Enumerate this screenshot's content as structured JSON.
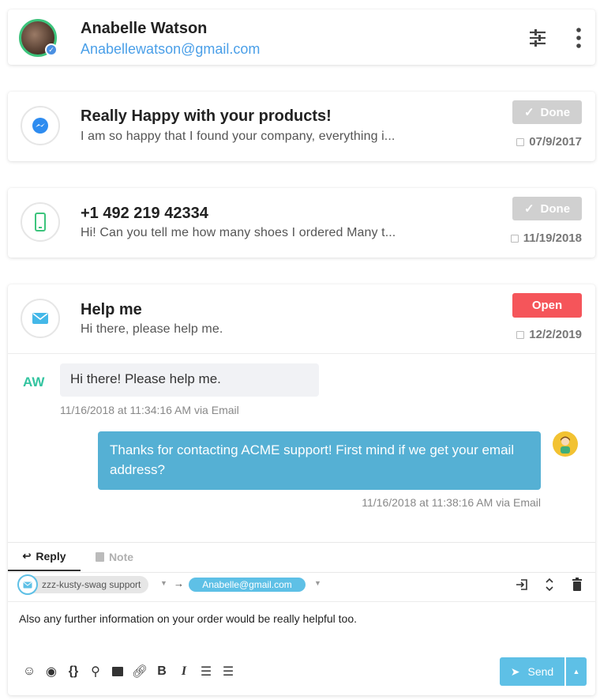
{
  "header": {
    "name": "Anabelle Watson",
    "email": "Anabellewatson@gmail.com"
  },
  "conversations": [
    {
      "title": "Really Happy with your products!",
      "preview": "I am so happy that I found your company, everything i...",
      "status": "Done",
      "date": "07/9/2017",
      "channel": "messenger-icon"
    },
    {
      "title": "+1 492 219 42334",
      "preview": "Hi! Can you tell me how many shoes I ordered Many t...",
      "status": "Done",
      "date": "11/19/2018",
      "channel": "phone-icon"
    },
    {
      "title": "Help me",
      "preview": "Hi there, please help me.",
      "status": "Open",
      "date": "12/2/2019",
      "channel": "email-icon"
    }
  ],
  "thread": {
    "customer_initials": "AW",
    "incoming": {
      "text": "Hi there! Please help me.",
      "meta": "11/16/2018 at 11:34:16 AM via Email"
    },
    "outgoing": {
      "text": "Thanks for contacting ACME support! First mind if we get your email address?",
      "meta": "11/16/2018 at 11:38:16 AM via Email"
    }
  },
  "composer": {
    "tabs": {
      "reply": "Reply",
      "note": "Note"
    },
    "from": "zzz-kusty-swag support",
    "to": "Anabelle@gmail.com",
    "body": "Also any further information on your order would be really helpful too.",
    "send_label": "Send"
  },
  "colors": {
    "accent": "#55b0d4",
    "open": "#f5555a",
    "done": "#d0d0d0",
    "initials": "#33c4a0",
    "link": "#4a9fe8"
  }
}
